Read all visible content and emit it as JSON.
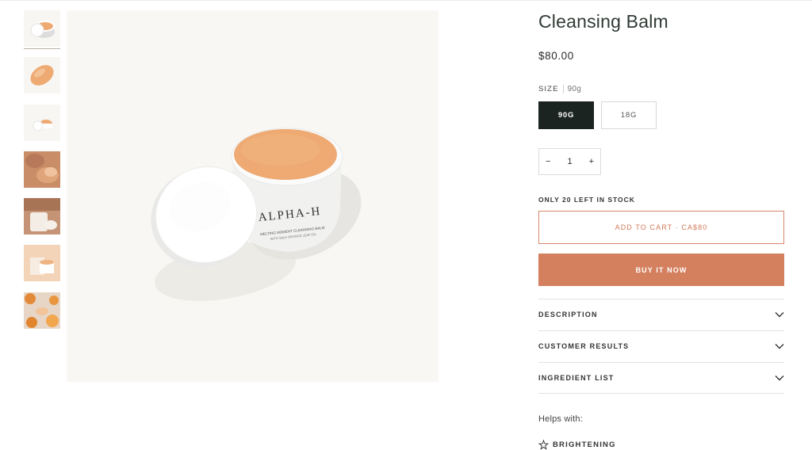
{
  "product": {
    "title": "Cleansing Balm",
    "price": "$80.00",
    "brand_on_jar": "ALPHA-H",
    "jar_text_line1": "MELTING MOMENT CLEANSING BALM",
    "jar_text_line2": "WITH WILD ORANGE LEAF OIL"
  },
  "size": {
    "label": "SIZE",
    "selected_value": "90g",
    "options": [
      "90G",
      "18G"
    ],
    "selected_index": 0
  },
  "quantity": {
    "minus": "−",
    "value": "1",
    "plus": "+"
  },
  "stock_text": "ONLY 20 LEFT IN STOCK",
  "buttons": {
    "add_to_cart": "ADD TO CART · CA$80",
    "buy_now": "BUY IT NOW"
  },
  "accordion": [
    {
      "label": "DESCRIPTION"
    },
    {
      "label": "CUSTOMER RESULTS"
    },
    {
      "label": "INGREDIENT LIST"
    }
  ],
  "helps_with": {
    "label": "Helps with:",
    "items": [
      {
        "label": "BRIGHTENING",
        "icon": "sparkle-icon"
      }
    ]
  },
  "colors": {
    "accent": "#d4805f",
    "dark": "#1b2421",
    "balm": "#eeaa72",
    "background_image": "#f9f7f3"
  },
  "gallery": {
    "thumbnail_count": 7,
    "selected_index": 0
  }
}
